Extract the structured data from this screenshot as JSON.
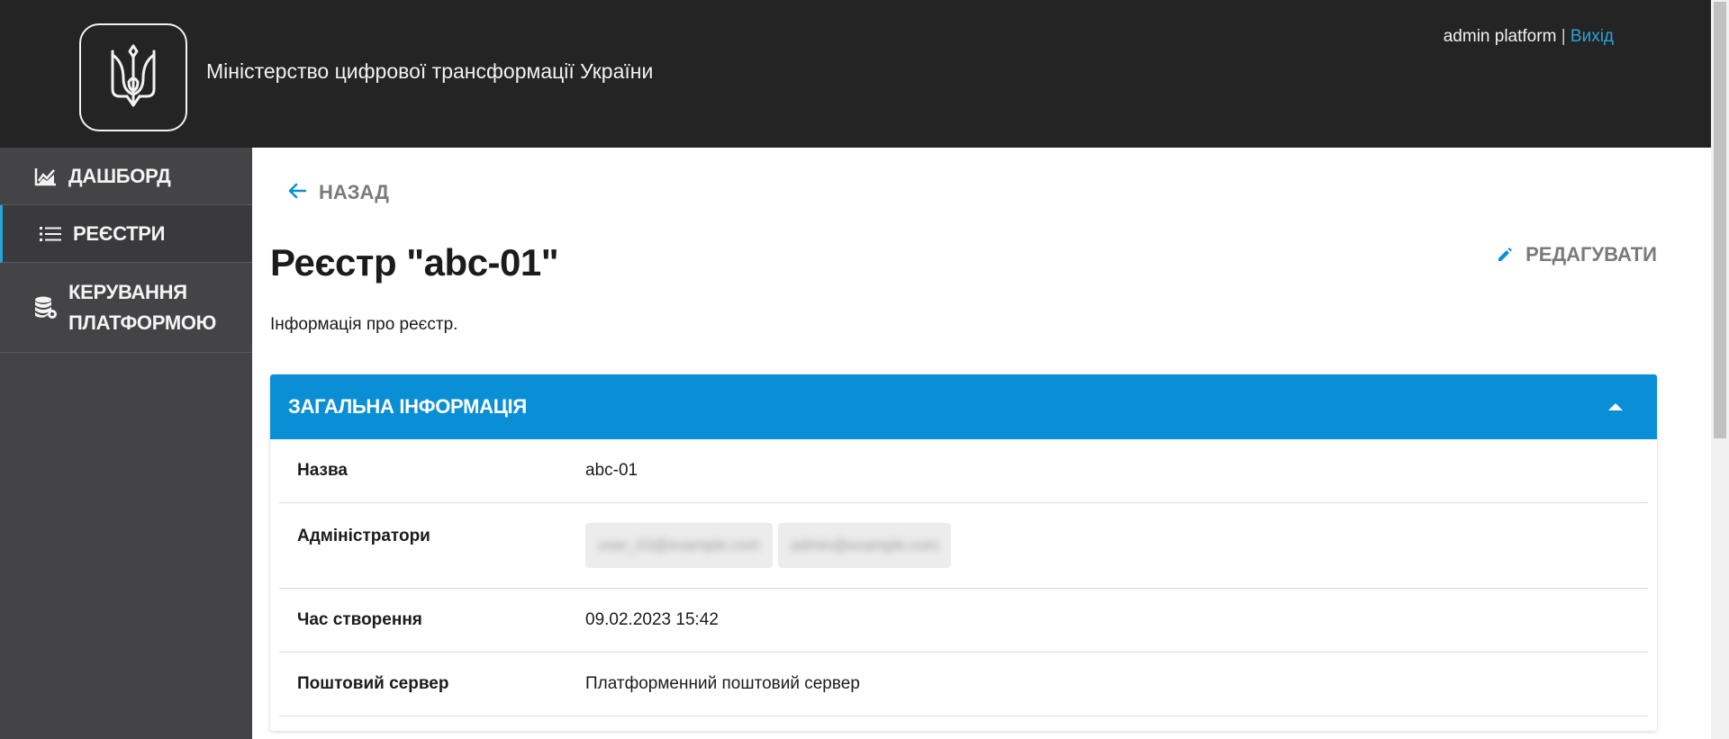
{
  "header": {
    "ministry_title": "Міністерство цифрової трансформації України",
    "user_name": "admin platform",
    "separator": "|",
    "logout_label": "Вихід"
  },
  "sidebar": {
    "items": [
      {
        "label": "ДАШБОРД",
        "icon": "chart-icon",
        "active": false
      },
      {
        "label": "РЕЄСТРИ",
        "icon": "list-icon",
        "active": true
      },
      {
        "label": "КЕРУВАННЯ ПЛАТФОРМОЮ",
        "icon": "database-gear-icon",
        "active": false
      }
    ]
  },
  "main": {
    "back_label": "НАЗАД",
    "title": "Реєстр \"abc-01\"",
    "edit_label": "РЕДАГУВАТИ",
    "subtitle": "Інформація про реєстр.",
    "panel": {
      "title": "ЗАГАЛЬНА ІНФОРМАЦІЯ",
      "rows": [
        {
          "label": "Назва",
          "value": "abc-01"
        },
        {
          "label": "Адміністратори",
          "chips": [
            "user_03@example.com",
            "admin@example.com"
          ]
        },
        {
          "label": "Час створення",
          "value": "09.02.2023 15:42"
        },
        {
          "label": "Поштовий сервер",
          "value": "Платформенний поштовий сервер"
        }
      ]
    }
  },
  "colors": {
    "header_bg": "#242424",
    "sidebar_bg": "#444446",
    "accent": "#0a8fd6",
    "link": "#2ca3d9"
  }
}
